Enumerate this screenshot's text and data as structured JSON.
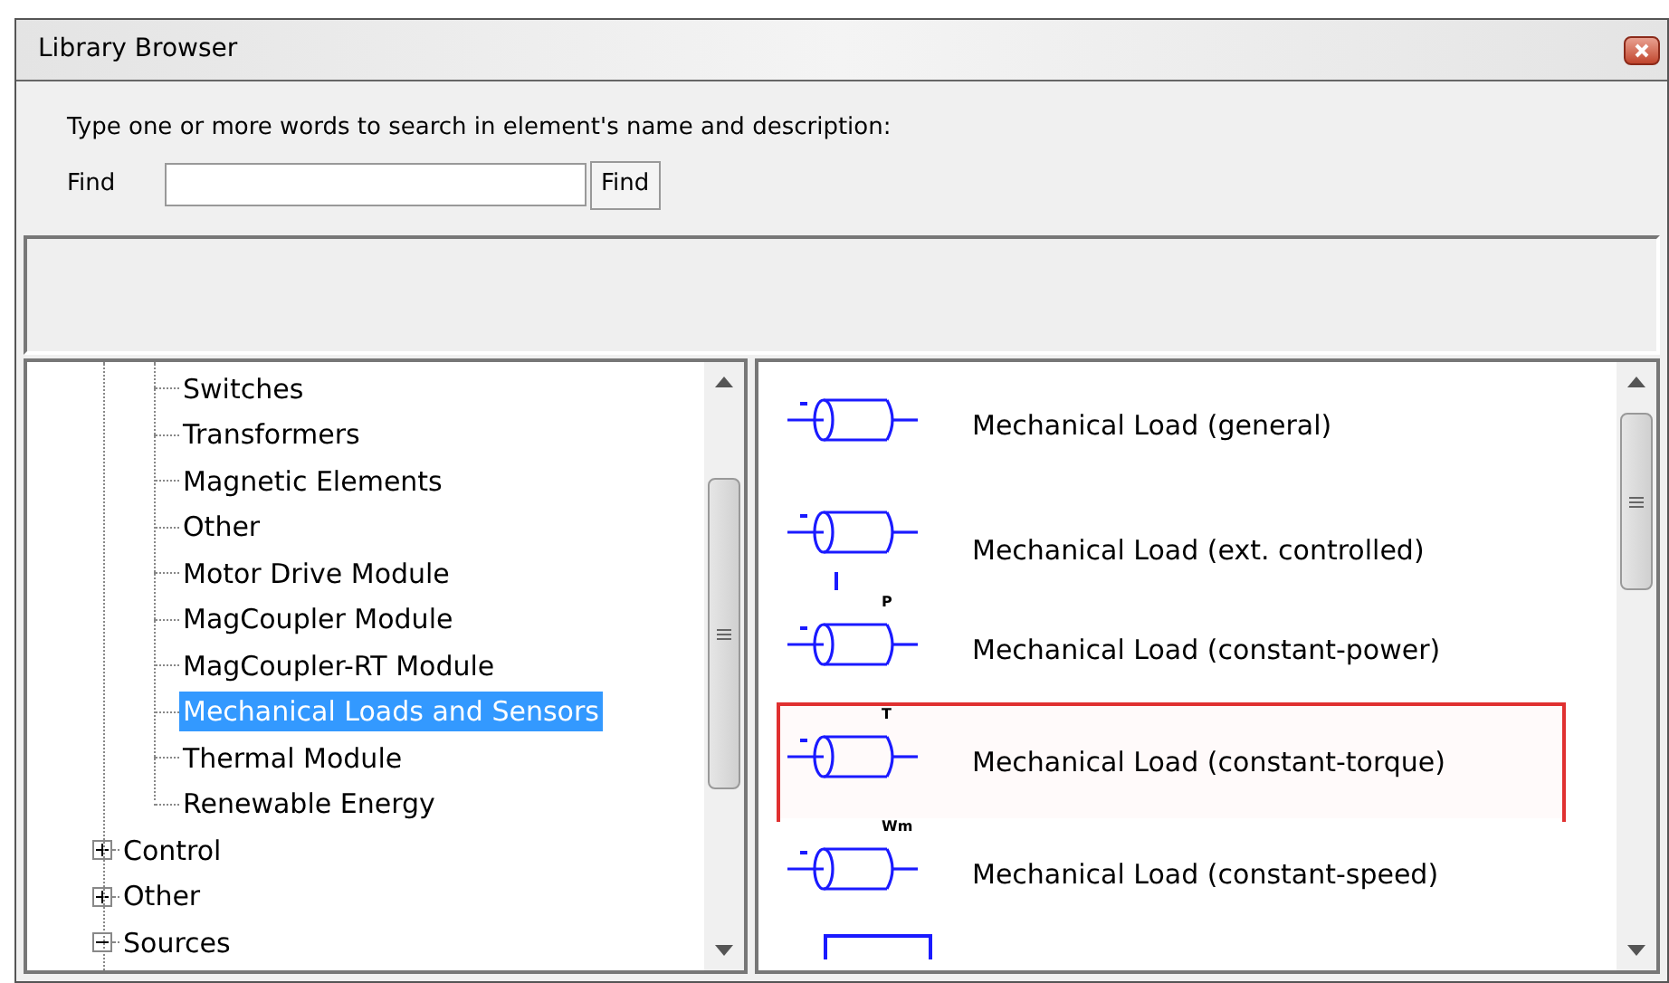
{
  "window": {
    "title": "Library Browser"
  },
  "search": {
    "prompt": "Type one or more words to search in element's name and  description:",
    "label": "Find",
    "button": "Find"
  },
  "tree": {
    "items": [
      {
        "children": [
          {
            "label": "Switches",
            "selected": false
          },
          {
            "label": "Transformers",
            "selected": false
          },
          {
            "label": "Magnetic Elements",
            "selected": false
          },
          {
            "label": "Other",
            "selected": false
          },
          {
            "label": "Motor Drive Module",
            "selected": false
          },
          {
            "label": "MagCoupler Module",
            "selected": false
          },
          {
            "label": "MagCoupler-RT Module",
            "selected": false
          },
          {
            "label": "Mechanical Loads and Sensors",
            "selected": true
          },
          {
            "label": "Thermal Module",
            "selected": false
          },
          {
            "label": "Renewable Energy",
            "selected": false
          }
        ]
      },
      {
        "label": "Control",
        "expanded": false,
        "selected": false
      },
      {
        "label": "Other",
        "expanded": false,
        "selected": false
      },
      {
        "label": "Sources",
        "expanded": true,
        "selected": false
      }
    ]
  },
  "elements": [
    {
      "kind": "load",
      "label": "Mechanical Load (general)",
      "selected": false
    },
    {
      "kind": "controlled",
      "label": "Mechanical Load (ext. controlled)",
      "selected": false
    },
    {
      "kind": "load",
      "symbol_label": "P",
      "label": "Mechanical Load (constant-power)",
      "selected": false
    },
    {
      "kind": "load",
      "symbol_label": "T",
      "label": "Mechanical Load (constant-torque)",
      "selected": true
    },
    {
      "kind": "load",
      "symbol_label": "Wm",
      "label": "Mechanical Load (constant-speed)",
      "selected": false
    },
    {
      "kind": "box"
    }
  ]
}
